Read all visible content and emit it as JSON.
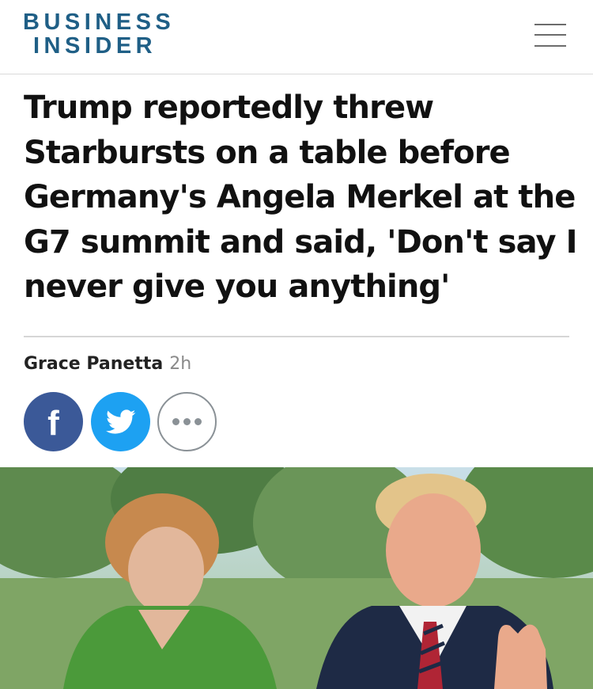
{
  "header": {
    "logo_line1": "BUSINESS",
    "logo_line2": "INSIDER",
    "brand_color": "#1f5f86"
  },
  "article": {
    "headline": "Trump reportedly threw Starbursts on a table before Germany's Angela Merkel at the G7 summit and said, 'Don't say I never give you anything'",
    "author": "Grace Panetta",
    "time_ago": "2h"
  },
  "share": {
    "facebook_icon": "facebook-icon",
    "twitter_icon": "twitter-icon",
    "more_icon": "more-dots-icon",
    "facebook_color": "#3b5998",
    "twitter_color": "#1da1f2"
  }
}
